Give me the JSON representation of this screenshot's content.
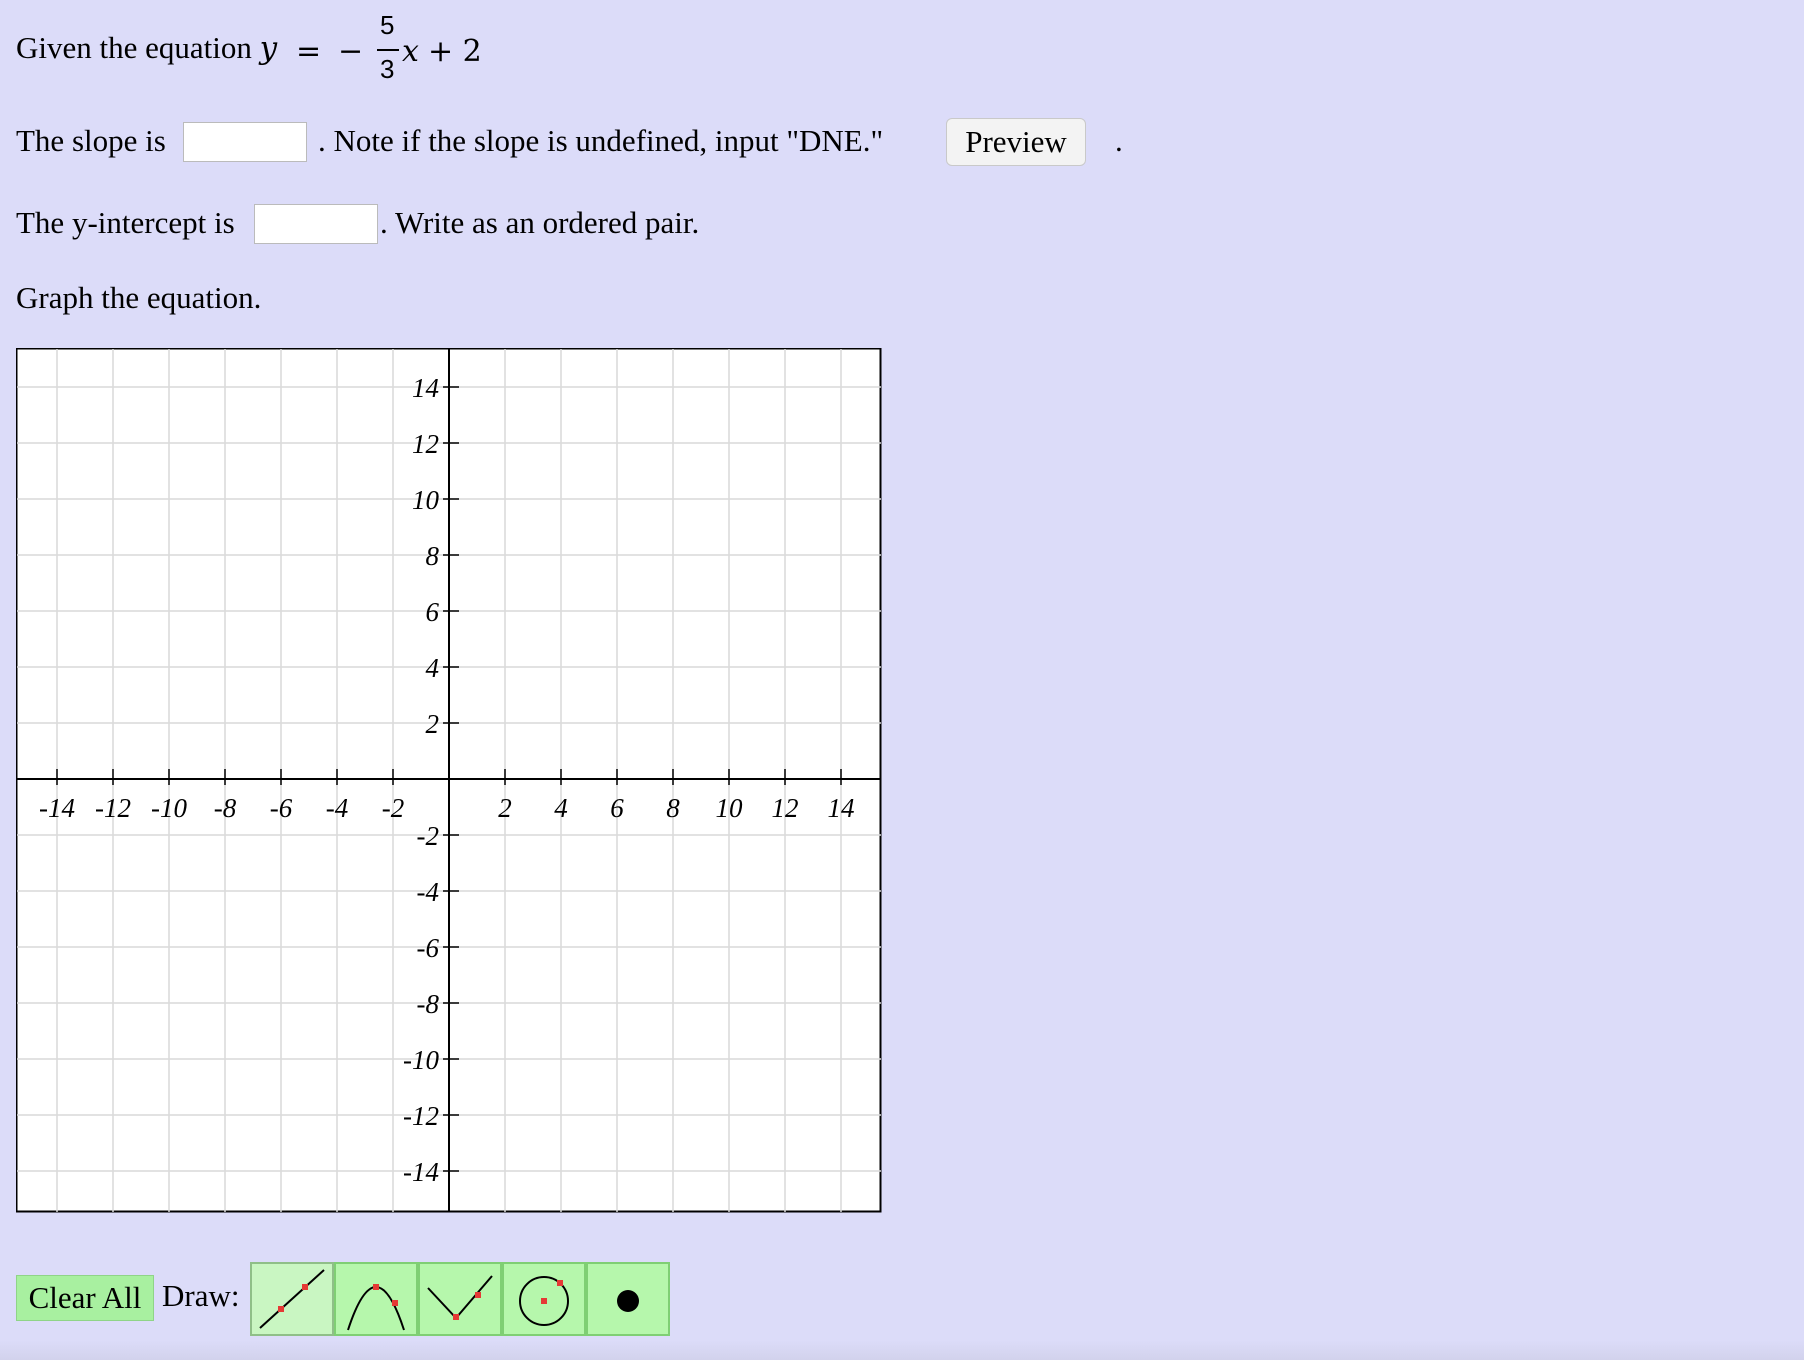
{
  "question": {
    "given_prefix": "Given the equation",
    "var_y": "y",
    "equals": "=",
    "minus": "−",
    "frac_num": "5",
    "frac_den": "3",
    "var_x": "x",
    "plus_term": "+ 2"
  },
  "slope": {
    "label": "The slope is",
    "input_value": "",
    "note": ". Note if the slope is undefined, input \"DNE.\"",
    "preview_label": "Preview",
    "trailing": "."
  },
  "intercept": {
    "label": "The y-intercept is",
    "input_value": "",
    "note": ". Write as an ordered pair."
  },
  "graph_prompt": "Graph the equation.",
  "chart_data": {
    "type": "scatter",
    "title": "",
    "xlabel": "",
    "ylabel": "",
    "xlim": [
      -15.2,
      15.6
    ],
    "ylim": [
      -15.2,
      15.6
    ],
    "grid": true,
    "x_ticks": [
      "-14",
      "-12",
      "-10",
      "-8",
      "-6",
      "-4",
      "-2",
      "2",
      "4",
      "6",
      "8",
      "10",
      "12",
      "14"
    ],
    "y_ticks": [
      "14",
      "12",
      "10",
      "8",
      "6",
      "4",
      "2",
      "-2",
      "-4",
      "-6",
      "-8",
      "-10",
      "-12",
      "-14"
    ],
    "series": []
  },
  "toolbar": {
    "clear_label": "Clear All",
    "draw_label": "Draw:",
    "tools": [
      "line-tool-icon",
      "parabola-up-tool-icon",
      "parabola-down-tool-icon",
      "circle-tool-icon",
      "point-tool-icon"
    ]
  },
  "colors": {
    "background": "#dcdcf9",
    "tool_green": "#b6f7ac",
    "handle_red": "#e53935"
  }
}
